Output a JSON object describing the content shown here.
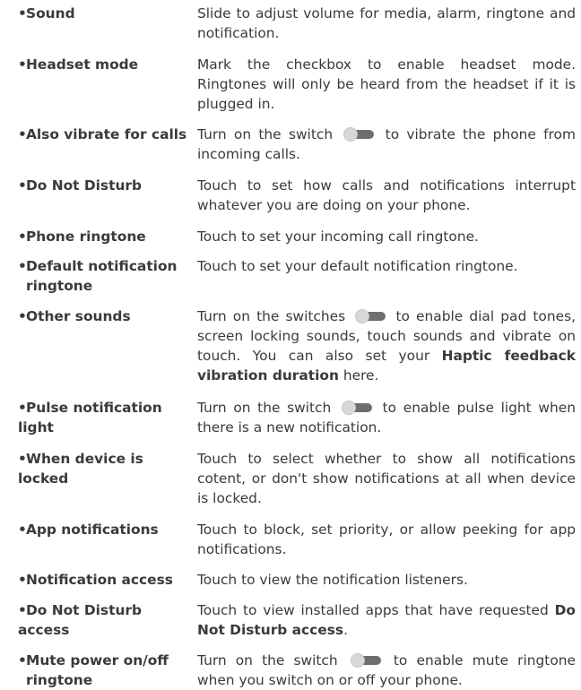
{
  "bullet": "•",
  "items": [
    {
      "term": "Sound",
      "desc": "Slide to adjust volume for media, alarm, ringtone and notification."
    },
    {
      "term": "Headset mode",
      "desc": "Mark the checkbox to enable headset mode. Ringtones will only be heard from the headset if it is plugged in."
    },
    {
      "term": "Also vibrate for calls",
      "desc_before": "Turn on the switch",
      "desc_after": "to vibrate the phone from incoming calls."
    },
    {
      "term": "Do Not Disturb",
      "desc": "Touch to set how calls and notifications interrupt whatever you are doing on your phone."
    },
    {
      "term": "Phone ringtone",
      "desc": "Touch to set your incoming call ringtone."
    },
    {
      "term": "Default notification",
      "term_cont": "ringtone",
      "desc": "Touch to set your default notification ringtone."
    },
    {
      "term": "Other sounds",
      "desc_before": "Turn on the switches",
      "desc_after": "to enable dial pad tones, screen locking sounds, touch sounds and vibrate on touch. You can also set your",
      "desc_bold": "Haptic feedback vibration duration",
      "desc_end": "here."
    },
    {
      "term": "Pulse notification light",
      "desc_before": "Turn on the switch",
      "desc_after": "to enable pulse light when there is a new notification."
    },
    {
      "term": "When device is locked",
      "desc": "Touch to select whether to show all notifications cotent, or don't show notifications at all when device is locked."
    },
    {
      "term": "App notifications",
      "desc": "Touch to block, set priority, or allow peeking for app notifications."
    },
    {
      "term": "Notification access",
      "desc": "Touch to view the notification listeners."
    },
    {
      "term": "Do Not Disturb access",
      "desc_before": "Touch to view installed apps that have requested",
      "desc_bold": "Do Not Disturb access",
      "desc_end": "."
    },
    {
      "term": "Mute power on/off",
      "term_cont": "ringtone",
      "desc_before": "Turn on the switch",
      "desc_after": "to enable mute ringtone when you switch on or off your phone."
    }
  ]
}
